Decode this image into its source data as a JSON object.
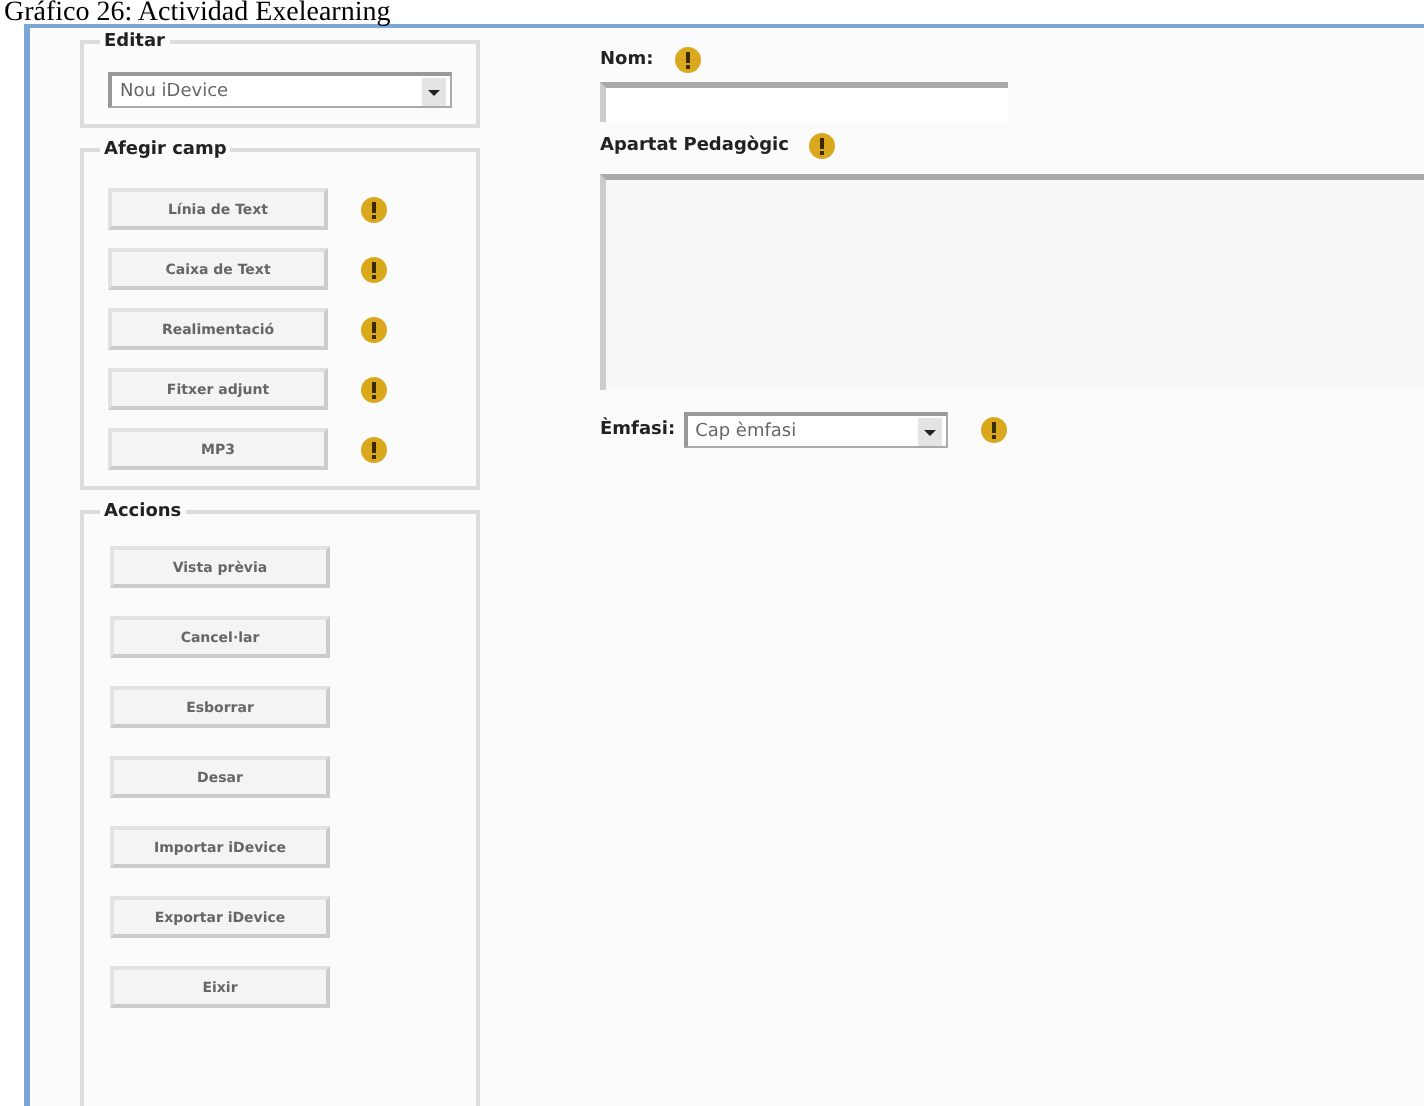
{
  "caption": "Gráfico 26: Actividad Exelearning",
  "editor": {
    "legend": "Editar",
    "select_value": "Nou iDevice"
  },
  "add_field": {
    "legend": "Afegir camp",
    "buttons": [
      {
        "label": "Línia de Text"
      },
      {
        "label": "Caixa de Text"
      },
      {
        "label": "Realimentació"
      },
      {
        "label": "Fitxer adjunt"
      },
      {
        "label": "MP3"
      }
    ]
  },
  "actions": {
    "legend": "Accions",
    "buttons": [
      "Vista prèvia",
      "Cancel·lar",
      "Esborrar",
      "Desar",
      "Importar iDevice",
      "Exportar iDevice",
      "Eixir"
    ]
  },
  "form": {
    "name_label": "Nom:",
    "section_label": "Apartat Pedagògic",
    "emphasis_label": "Èmfasi:",
    "emphasis_value": "Cap èmfasi"
  }
}
